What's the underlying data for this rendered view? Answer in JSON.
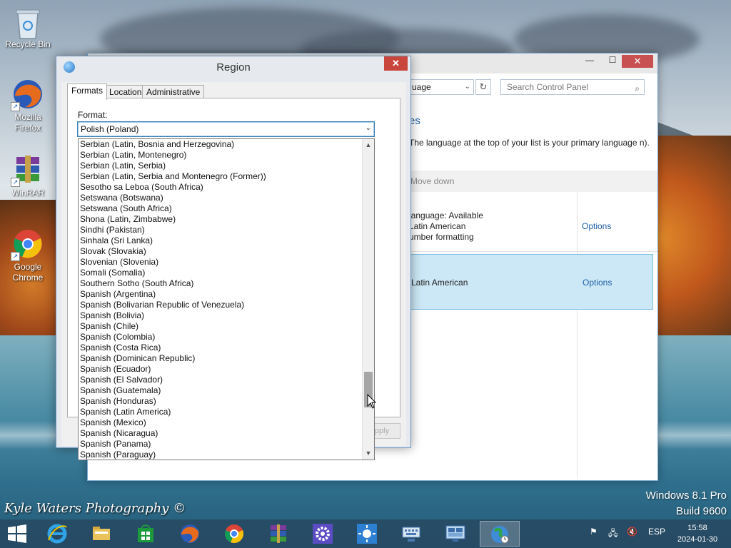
{
  "desktop": {
    "icons": [
      {
        "label": "Recycle Bin"
      },
      {
        "label": "Mozilla Firefox"
      },
      {
        "label": "WinRAR"
      },
      {
        "label": "Google Chrome"
      }
    ],
    "watermark": "Kyle Waters Photography ©",
    "os_name": "Windows 8.1 Pro",
    "os_build": "Build 9600"
  },
  "control_panel": {
    "address_text": "uage",
    "search_placeholder": "Search Control Panel",
    "heading": "es",
    "description": "The language at the top of your list is your primary language n).",
    "move_down": "Move down",
    "row1_lines": [
      "language: Available",
      "Latin American",
      "umber formatting"
    ],
    "row1_options": "Options",
    "row2_text": "Latin American",
    "row2_options": "Options"
  },
  "region_dialog": {
    "title": "Region",
    "close_label": "✕",
    "tabs": [
      {
        "label": "Formats",
        "active": true
      },
      {
        "label": "Location",
        "active": false
      },
      {
        "label": "Administrative",
        "active": false
      }
    ],
    "format_label": "Format:",
    "format_value": "Polish (Poland)",
    "apply_label": "pply",
    "dropdown_items": [
      "Serbian (Latin, Bosnia and Herzegovina)",
      "Serbian (Latin, Montenegro)",
      "Serbian (Latin, Serbia)",
      "Serbian (Latin, Serbia and Montenegro (Former))",
      "Sesotho sa Leboa (South Africa)",
      "Setswana (Botswana)",
      "Setswana (South Africa)",
      "Shona (Latin, Zimbabwe)",
      "Sindhi (Pakistan)",
      "Sinhala (Sri Lanka)",
      "Slovak (Slovakia)",
      "Slovenian (Slovenia)",
      "Somali (Somalia)",
      "Southern Sotho (South Africa)",
      "Spanish (Argentina)",
      "Spanish (Bolivarian Republic of Venezuela)",
      "Spanish (Bolivia)",
      "Spanish (Chile)",
      "Spanish (Colombia)",
      "Spanish (Costa Rica)",
      "Spanish (Dominican Republic)",
      "Spanish (Ecuador)",
      "Spanish (El Salvador)",
      "Spanish (Guatemala)",
      "Spanish (Honduras)",
      "Spanish (Latin America)",
      "Spanish (Mexico)",
      "Spanish (Nicaragua)",
      "Spanish (Panama)",
      "Spanish (Paraguay)"
    ]
  },
  "taskbar": {
    "apps": [
      {
        "name": "internet-explorer-icon"
      },
      {
        "name": "file-explorer-icon"
      },
      {
        "name": "store-icon"
      },
      {
        "name": "firefox-icon"
      },
      {
        "name": "chrome-icon"
      },
      {
        "name": "winrar-icon"
      },
      {
        "name": "settings-gear-icon"
      },
      {
        "name": "brightness-icon"
      },
      {
        "name": "keyboard-icon"
      },
      {
        "name": "remote-desktop-icon"
      },
      {
        "name": "region-globe-icon"
      }
    ],
    "language": "ESP",
    "time": "15:58",
    "date": "2024-01-30"
  },
  "colors": {
    "accent_blue": "#1e5fa8",
    "close_red": "#c9463d",
    "selection_blue": "#cce8f6"
  }
}
